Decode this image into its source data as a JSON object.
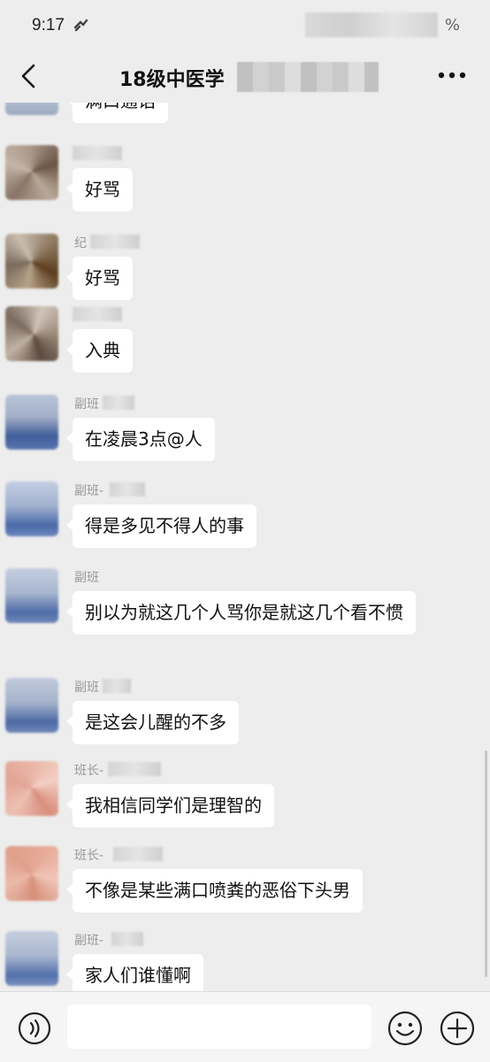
{
  "status_bar": {
    "time": "9:17",
    "battery_text": "%"
  },
  "header": {
    "title": "18级中医学",
    "back_icon": "chevron-left-icon",
    "more_icon": "more-dots-icon"
  },
  "messages": [
    {
      "sender": "",
      "text": "满口通话"
    },
    {
      "sender": "",
      "text": "好骂"
    },
    {
      "sender": "纪",
      "text": "好骂"
    },
    {
      "sender": "",
      "text": "入典"
    },
    {
      "sender": "副班",
      "text": "在凌晨3点@人"
    },
    {
      "sender": "副班-",
      "text": "得是多见不得人的事"
    },
    {
      "sender": "副班",
      "text": "别以为就这几个人骂你是就这几个看不惯"
    },
    {
      "sender": "副班",
      "text": "是这会儿醒的不多"
    },
    {
      "sender": "班长-",
      "text": "我相信同学们是理智的"
    },
    {
      "sender": "班长-",
      "text": "不像是某些满口喷粪的恶俗下头男"
    },
    {
      "sender": "副班-",
      "text": "家人们谁懂啊"
    }
  ],
  "input_bar": {
    "placeholder": "",
    "voice_icon": "voice-icon",
    "emoji_icon": "emoji-icon",
    "plus_icon": "plus-icon"
  },
  "colors": {
    "background": "#ededed",
    "bubble": "#ffffff",
    "text": "#111111",
    "sender": "#999999"
  }
}
